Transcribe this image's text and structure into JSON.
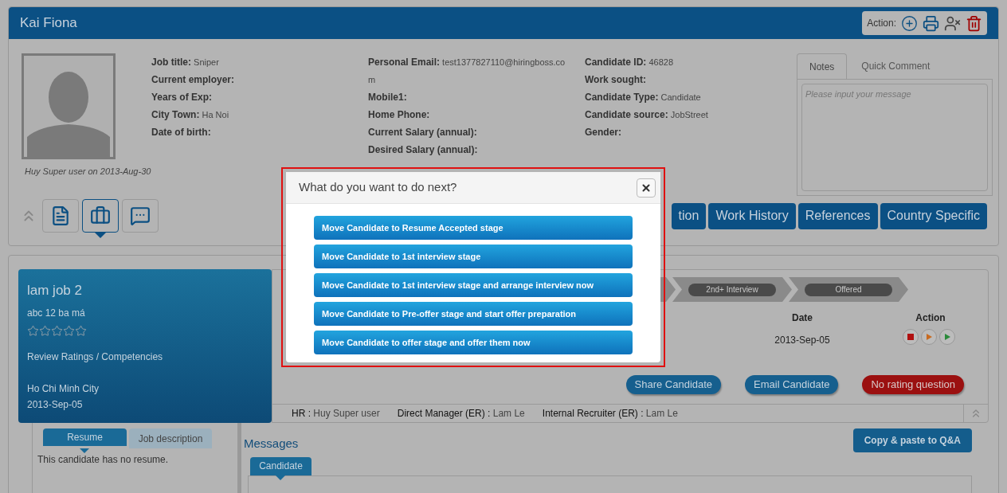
{
  "candidate": {
    "name": "Kai Fiona",
    "action_label": "Action:",
    "created_by": "Huy Super user on 2013-Aug-30",
    "fields": [
      [
        {
          "label": "Job title:",
          "value": "Sniper"
        },
        {
          "label": "Current employer:"
        },
        {
          "label": "Years of Exp:"
        },
        {
          "label": "City Town:",
          "value": "Ha Noi"
        },
        {
          "label": "Date of birth:"
        }
      ],
      [
        {
          "label": "Personal Email:",
          "value": "test1377827110@hiringboss.com"
        },
        {
          "label": "Mobile1:"
        },
        {
          "label": "Home Phone:"
        },
        {
          "label": "Current Salary (annual):"
        },
        {
          "label": "Desired Salary (annual):"
        }
      ],
      [
        {
          "label": "Candidate ID:",
          "value": "46828"
        },
        {
          "label": "Work sought:"
        },
        {
          "label": "Candidate Type:",
          "value": "Candidate"
        },
        {
          "label": "Candidate source:",
          "value": "JobStreet"
        },
        {
          "label": "Gender:"
        }
      ]
    ]
  },
  "notes": {
    "tabs": [
      {
        "label": "Notes",
        "selected": true
      },
      {
        "label": "Quick Comment",
        "selected": false
      }
    ],
    "placeholder": "Please input your message"
  },
  "view_buttons": [
    {
      "kind": "resume",
      "selected": false
    },
    {
      "kind": "jobs",
      "selected": true
    },
    {
      "kind": "messages",
      "selected": false
    }
  ],
  "section_tabs": [
    "tion",
    "Work History",
    "References",
    "Country Specific"
  ],
  "job": {
    "title": "lam job 2",
    "subtitle": "abc 12 ba má",
    "stars": 0,
    "review_link": "Review Ratings / Competencies",
    "location": "Ho Chi Minh City",
    "date": "2013-Sep-05"
  },
  "stages": [
    "2nd+ Interview",
    "Offered"
  ],
  "table": {
    "columns": [
      "Date",
      "Action"
    ],
    "rows": [
      {
        "date": "2013-Sep-05"
      }
    ]
  },
  "buttons": [
    {
      "label": "Share Candidate",
      "kind": "primary"
    },
    {
      "label": "Email Candidate",
      "kind": "primary"
    },
    {
      "label": "No rating question",
      "kind": "danger"
    }
  ],
  "team": [
    {
      "role": "HR :",
      "name": "Huy Super user"
    },
    {
      "role": "Direct Manager (ER) :",
      "name": "Lam Le"
    },
    {
      "role": "Internal Recruiter (ER) :",
      "name": "Lam Le"
    }
  ],
  "resume": {
    "tabs": [
      {
        "label": "Resume",
        "selected": true
      },
      {
        "label": "Job description",
        "selected": false
      }
    ],
    "text": "This candidate has no resume."
  },
  "messages": {
    "title": "Messages",
    "copy_button": "Copy & paste to Q&A",
    "tabs": [
      {
        "label": "Candidate",
        "selected": true
      }
    ]
  },
  "dialog": {
    "title": "What do you want to do next?",
    "options": [
      "Move Candidate to Resume Accepted stage",
      "Move Candidate to 1st interview stage",
      "Move Candidate to 1st interview stage and arrange interview now",
      "Move Candidate to Pre-offer stage and start offer preparation",
      "Move Candidate to offer stage and offer them now"
    ]
  }
}
